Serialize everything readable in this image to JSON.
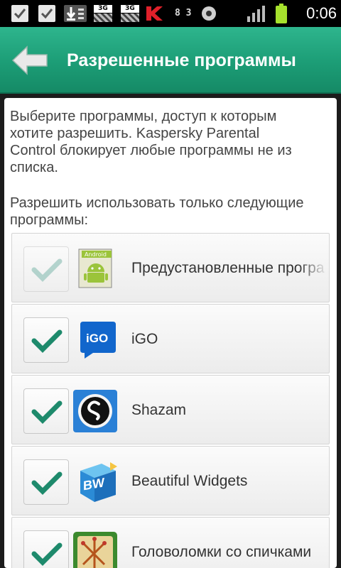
{
  "status_bar": {
    "time": "0:06",
    "network_label_1": "3G",
    "network_label_2": "3G",
    "indicator_text": "8 3",
    "icons": [
      "check-notification-icon",
      "check-notification-icon",
      "download-icon",
      "3g-icon",
      "3g-icon",
      "kaspersky-icon",
      "indicator-icon",
      "record-icon",
      "signal-icon",
      "battery-icon"
    ],
    "battery_color": "#a6e12d"
  },
  "header": {
    "title": "Разрешенные программы",
    "back_icon": "back-arrow-icon",
    "color": "#1c9d76"
  },
  "main": {
    "description": "Выберите программы, доступ к которым хотите разрешить. Kaspersky Parental Control блокирует любые программы не из списка.",
    "subheading": "Разрешить использовать только следующие программы:",
    "apps": [
      {
        "label": "Предустановленные програ",
        "checked": true,
        "disabled": true,
        "icon": "android-app-icon",
        "icon_text": "Android"
      },
      {
        "label": "iGO",
        "checked": true,
        "disabled": false,
        "icon": "igo-app-icon",
        "icon_text": "iGO"
      },
      {
        "label": "Shazam",
        "checked": true,
        "disabled": false,
        "icon": "shazam-app-icon"
      },
      {
        "label": "Beautiful Widgets",
        "checked": true,
        "disabled": false,
        "icon": "beautiful-widgets-app-icon",
        "icon_text": "BW"
      },
      {
        "label": "Головоломки со спичками",
        "checked": true,
        "disabled": false,
        "icon": "matches-puzzle-app-icon"
      }
    ],
    "check_color": "#1e8a6c"
  }
}
